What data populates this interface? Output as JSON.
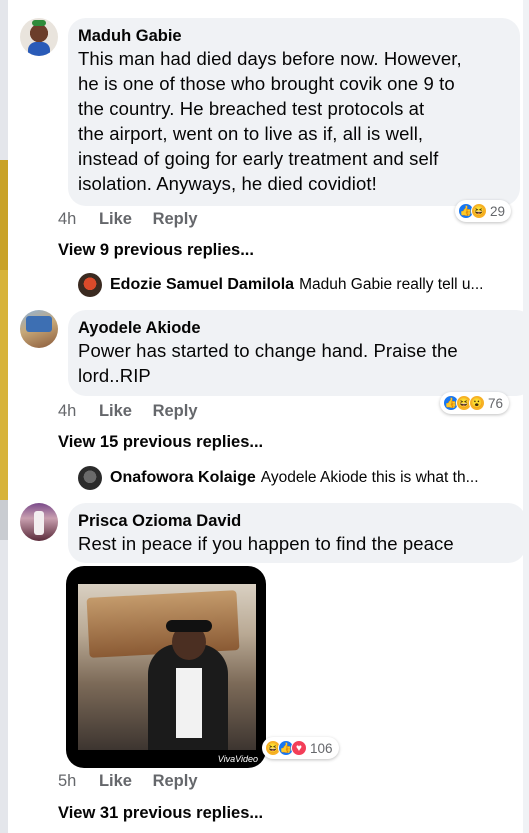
{
  "comments": [
    {
      "author": "Maduh Gabie",
      "text_lines": [
        "This man had died days before now. However,",
        "he is one of those who brought covik one 9 to",
        "the country. He breached test protocols at",
        "the airport, went on to live as if, all is well,",
        "instead of going for early treatment and self",
        "isolation. Anyways, he died covidiot!"
      ],
      "time": "4h",
      "like_label": "Like",
      "reply_label": "Reply",
      "reactions": [
        "like-icon",
        "haha-icon"
      ],
      "reaction_count": "29",
      "view_previous": "View 9 previous replies...",
      "latest_reply": {
        "author": "Edozie Samuel Damilola",
        "text": "Maduh Gabie really tell u..."
      }
    },
    {
      "author": "Ayodele Akiode",
      "text_lines": [
        "Power has started to change hand. Praise the",
        "lord..RIP"
      ],
      "time": "4h",
      "like_label": "Like",
      "reply_label": "Reply",
      "reactions": [
        "like-icon",
        "haha-icon",
        "wow-icon"
      ],
      "reaction_count": "76",
      "view_previous": "View 15 previous replies...",
      "latest_reply": {
        "author": "Onafowora Kolaige",
        "text": "Ayodele Akiode this is what th..."
      }
    },
    {
      "author": "Prisca Ozioma David",
      "text_lines": [
        "Rest in peace if you happen to find the peace"
      ],
      "attachment": {
        "type": "video-thumbnail",
        "watermark": "VivaVideo"
      },
      "time": "5h",
      "like_label": "Like",
      "reply_label": "Reply",
      "reactions": [
        "haha-icon",
        "like-icon",
        "love-icon"
      ],
      "reaction_count": "106",
      "view_previous": "View 31 previous replies..."
    }
  ],
  "colors": {
    "bubble": "#f0f2f5",
    "meta": "#65676b",
    "like": "#1877f2",
    "haha": "#f7b125",
    "love": "#f33e58"
  }
}
